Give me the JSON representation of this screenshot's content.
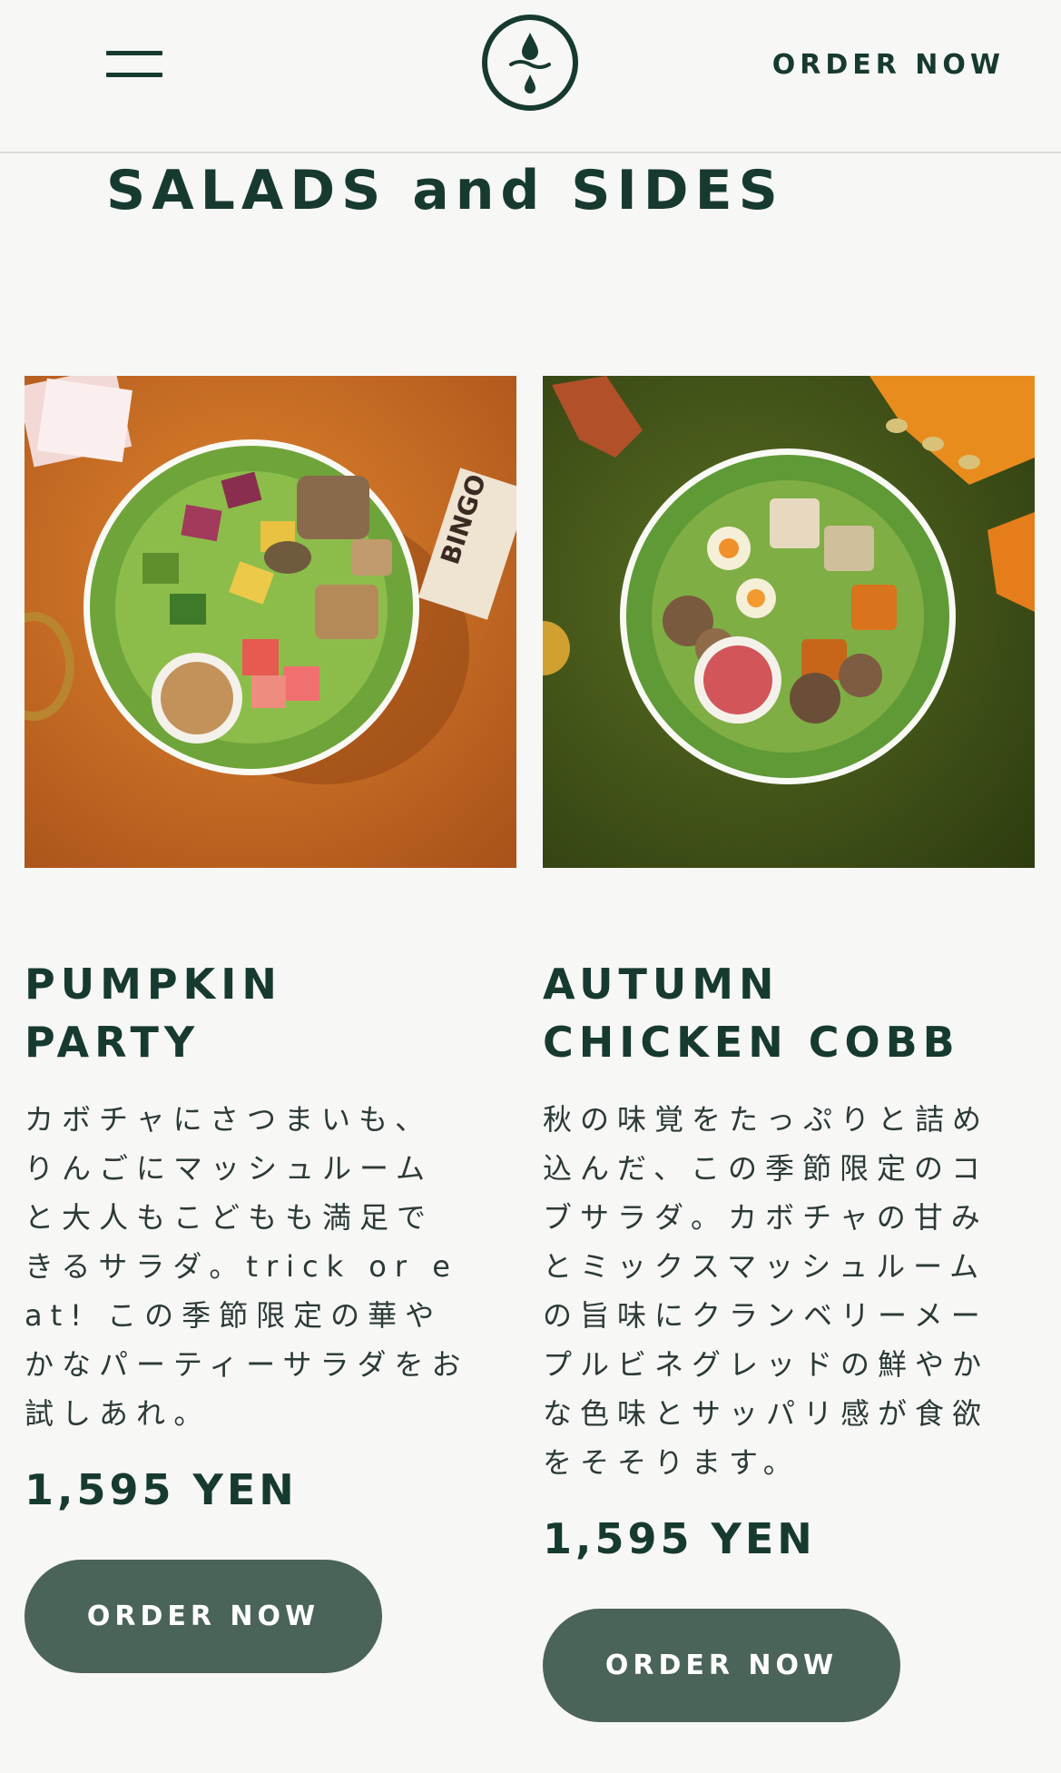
{
  "header": {
    "menu_icon": "hamburger-menu-icon",
    "logo_icon": "water-drop-logo-icon",
    "order_label": "ORDER NOW"
  },
  "section": {
    "title": "SALADS and SIDES"
  },
  "products": [
    {
      "image": "pumpkin-party-salad-photo",
      "name": "PUMPKIN PARTY",
      "description": "カボチャにさつまいも、りんごにマッシュルームと大人もこどもも満足できるサラダ。trick or eat! この季節限定の華やかなパーティーサラダをお試しあれ。",
      "price": "1,595 YEN",
      "button_label": "ORDER NOW"
    },
    {
      "image": "autumn-chicken-cobb-salad-photo",
      "name": "AUTUMN CHICKEN COBB",
      "description": "秋の味覚をたっぷりと詰め込んだ、この季節限定のコブサラダ。カボチャの甘みとミックスマッシュルームの旨味にクランベリーメープルビネグレッドの鮮やかな色味とサッパリ感が食欲をそそります。",
      "price": "1,595 YEN",
      "button_label": "ORDER NOW"
    }
  ],
  "colors": {
    "brand_green": "#173a30",
    "button_green": "#4b6459",
    "background": "#f7f7f6",
    "photo1_background": "#c86a1e",
    "photo2_background": "#4a5e1c"
  }
}
